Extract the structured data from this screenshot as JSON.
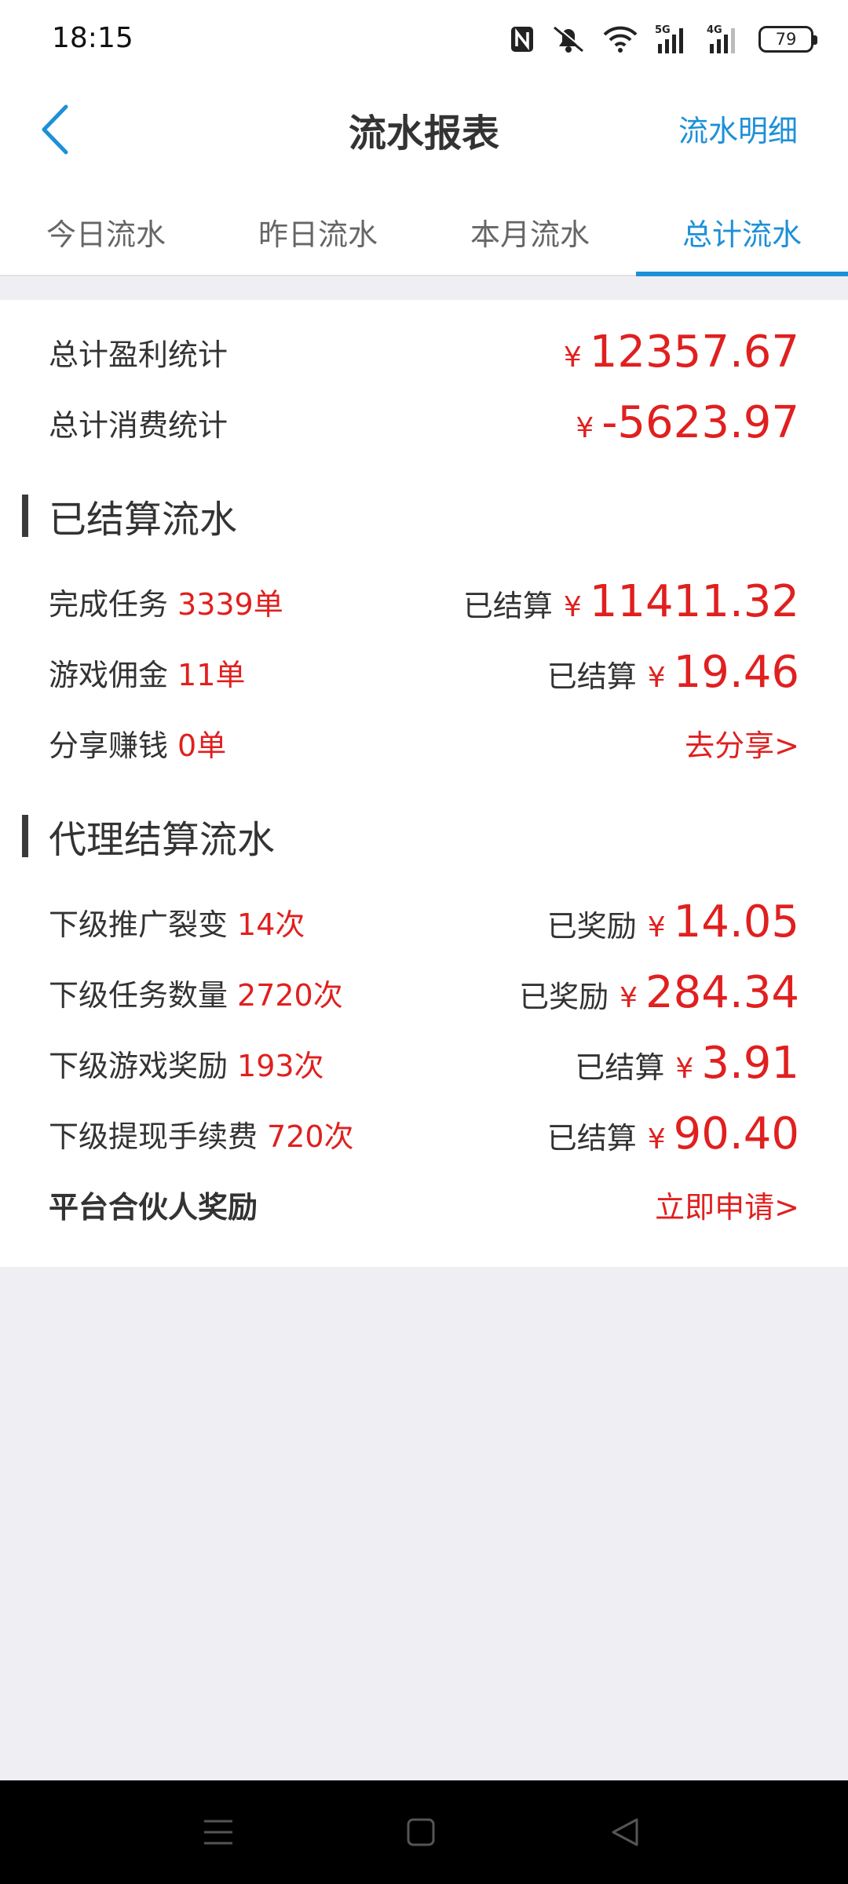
{
  "status_bar": {
    "time": "18:15",
    "battery": "79",
    "icons": [
      "nfc-icon",
      "silent-bell-icon",
      "wifi-icon",
      "signal-5g-icon",
      "signal-4g-icon",
      "battery-icon"
    ]
  },
  "header": {
    "back_icon": "chevron-left-icon",
    "title": "流水报表",
    "right_link": "流水明细"
  },
  "tabs": [
    {
      "label": "今日流水",
      "active": false
    },
    {
      "label": "昨日流水",
      "active": false
    },
    {
      "label": "本月流水",
      "active": false
    },
    {
      "label": "总计流水",
      "active": true
    }
  ],
  "summary": {
    "profit_label": "总计盈利统计",
    "profit_currency": "¥",
    "profit_value": "12357.67",
    "consume_label": "总计消费统计",
    "consume_currency": "¥",
    "consume_value": "-5623.97"
  },
  "settled_section": {
    "title": "已结算流水",
    "rows": [
      {
        "label": "完成任务",
        "count": "3339单",
        "status": "已结算",
        "currency": "¥",
        "amount": "11411.32"
      },
      {
        "label": "游戏佣金",
        "count": "11单",
        "status": "已结算",
        "currency": "¥",
        "amount": "19.46"
      },
      {
        "label": "分享赚钱",
        "count": "0单",
        "action": "去分享>"
      }
    ]
  },
  "agent_section": {
    "title": "代理结算流水",
    "rows": [
      {
        "label": "下级推广裂变",
        "count": "14次",
        "status": "已奖励",
        "currency": "¥",
        "amount": "14.05"
      },
      {
        "label": "下级任务数量",
        "count": "2720次",
        "status": "已奖励",
        "currency": "¥",
        "amount": "284.34"
      },
      {
        "label": "下级游戏奖励",
        "count": "193次",
        "status": "已结算",
        "currency": "¥",
        "amount": "3.91"
      },
      {
        "label": "下级提现手续费",
        "count": "720次",
        "status": "已结算",
        "currency": "¥",
        "amount": "90.40"
      },
      {
        "label": "平台合伙人奖励",
        "action": "立即申请>"
      }
    ]
  },
  "navbar": {
    "icons": [
      "menu-icon",
      "home-square-icon",
      "back-triangle-icon"
    ]
  },
  "colors": {
    "accent_blue": "#1e90d8",
    "money_red": "#e0201f",
    "background": "#eeeef3"
  }
}
